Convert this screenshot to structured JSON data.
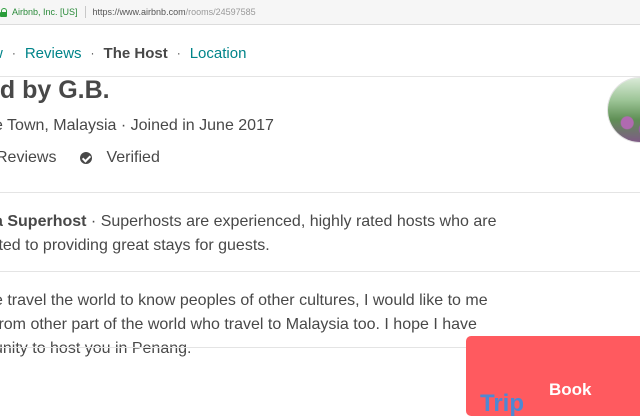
{
  "browser": {
    "origin": "Airbnb, Inc. [US]",
    "url_scheme": "https://www.airbnb.com",
    "url_path": "/rooms/24597585"
  },
  "subnav": {
    "items": [
      {
        "label": "w",
        "active": false
      },
      {
        "label": "Reviews",
        "active": false
      },
      {
        "label": "The Host",
        "active": true
      },
      {
        "label": "Location",
        "active": false
      }
    ],
    "separator": "·"
  },
  "host": {
    "title": "ed by G.B.",
    "meta": "e Town, Malaysia · Joined in June 2017",
    "reviews_label": "Reviews",
    "verified_label": "Verified"
  },
  "superhost": {
    "strong": "a Superhost",
    "text": " · Superhosts are experienced, highly rated hosts who are",
    "line2": "tted to providing great stays for guests."
  },
  "about": {
    "line1": "e travel the world to know peoples of other cultures, I would like to me",
    "line2": "from other part of the world who travel to Malaysia too.  I hope I have",
    "line3": "unity to host you in Penang."
  },
  "book": {
    "label": "Book",
    "ghost": "Trip"
  },
  "colors": {
    "teal_link": "#008489",
    "text": "#484848",
    "book_button": "#ff5a5f"
  }
}
